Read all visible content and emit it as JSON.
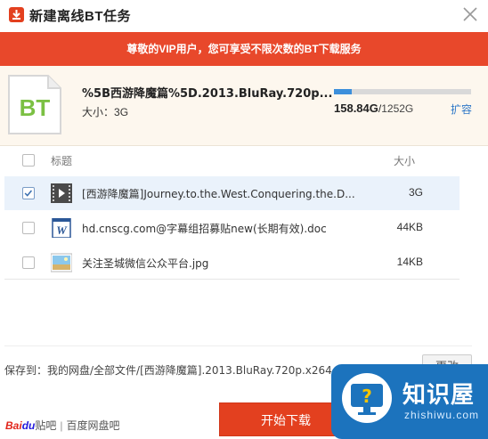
{
  "window": {
    "title": "新建离线BT任务",
    "logo_icon": "download-logo-icon",
    "close_icon": "close-icon"
  },
  "vip_banner": {
    "text": "尊敬的VIP用户，您可享受不限次数的BT下载服务"
  },
  "torrent": {
    "icon_label": "BT",
    "filename": "%5B西游降魔篇%5D.2013.BluRay.720p...",
    "size_label": "大小：",
    "size_value": "3G"
  },
  "quota": {
    "used": "158.84G",
    "separator": "/",
    "total": "1252G",
    "used_fraction": 0.127,
    "expand_label": "扩容"
  },
  "file_list": {
    "header": {
      "title": "标题",
      "size": "大小"
    },
    "rows": [
      {
        "icon": "video-file-icon",
        "title": "[西游降魔篇]Journey.to.the.West.Conquering.the.D...",
        "size": "3G",
        "checked": true,
        "selected": true
      },
      {
        "icon": "word-doc-icon",
        "title": "hd.cnscg.com@字幕组招募贴new(长期有效).doc",
        "size": "44KB",
        "checked": false,
        "selected": false
      },
      {
        "icon": "image-file-icon",
        "title": "关注圣城微信公众平台.jpg",
        "size": "14KB",
        "checked": false,
        "selected": false
      }
    ]
  },
  "save": {
    "label": "保存到：",
    "path": "我的网盘/全部文件/[西游降魔篇].2013.BluRay.720p.x264.AC3-CnSCG[...",
    "change_label": "更改"
  },
  "footer": {
    "baidu_bai": "Bai",
    "baidu_du": "du",
    "baidu_tieba": "贴吧",
    "baidu_sep": "|",
    "baidu_pan": "百度网盘吧",
    "start_label": "开始下载"
  },
  "watermark": {
    "main": "知识屋",
    "sub": "zhishiwu.com"
  },
  "colors": {
    "accent_red": "#e3401f",
    "vip_red": "#e8482b",
    "link_blue": "#2f78c8",
    "quota_blue": "#3c8fdb",
    "bt_green": "#7bc043"
  }
}
